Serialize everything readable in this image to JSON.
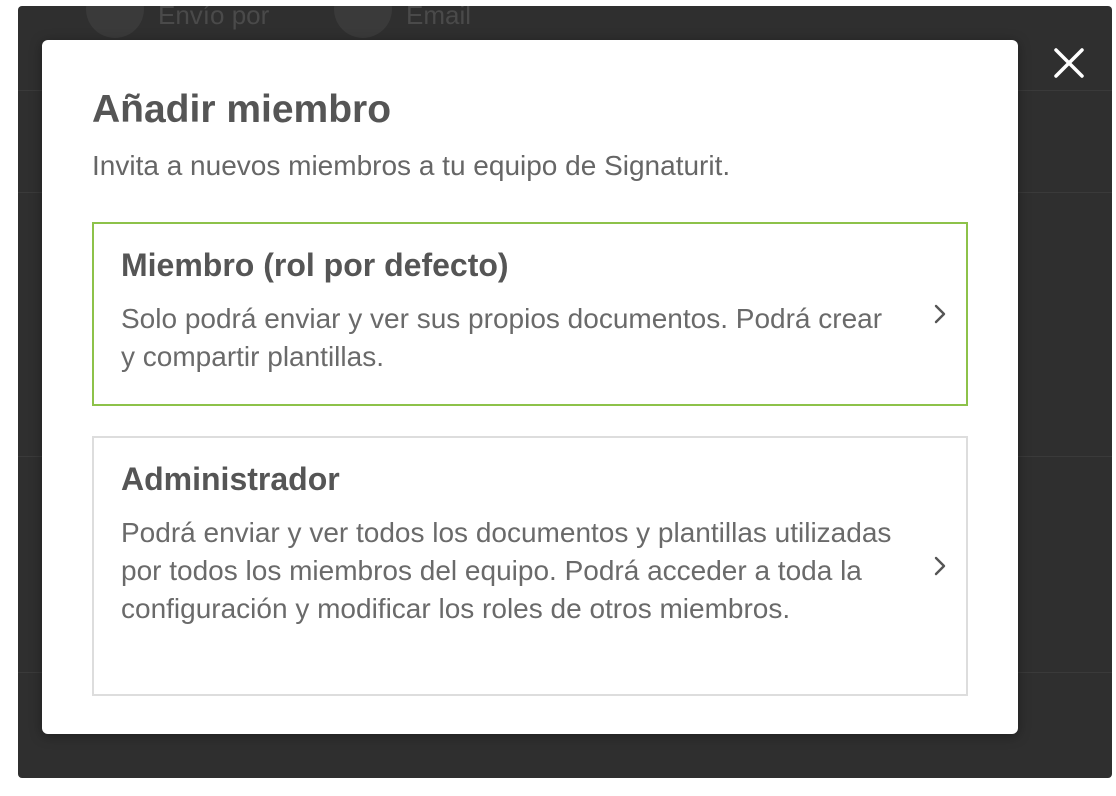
{
  "background": {
    "items": [
      {
        "label": "Envío por"
      },
      {
        "label": "Email"
      }
    ]
  },
  "modal": {
    "title": "Añadir miembro",
    "subtitle": "Invita a nuevos miembros a tu equipo de Signaturit.",
    "options": [
      {
        "title": "Miembro (rol por defecto)",
        "description": "Solo podrá enviar y ver sus propios documentos. Podrá crear y compartir plantillas.",
        "selected": true
      },
      {
        "title": "Administrador",
        "description": "Podrá enviar y ver todos los documentos y plantillas utilizadas por todos los miembros del equipo. Podrá acceder a toda la configuración y modificar los roles de otros miembros.",
        "selected": false
      }
    ]
  },
  "icons": {
    "close": "close-icon",
    "chevron": "chevron-right-icon"
  },
  "colors": {
    "overlay": "#2f2f2f",
    "selected_border": "#8dc24a",
    "border": "#dddddd",
    "text_dark": "#555555",
    "text_body": "#6a6a6a"
  }
}
